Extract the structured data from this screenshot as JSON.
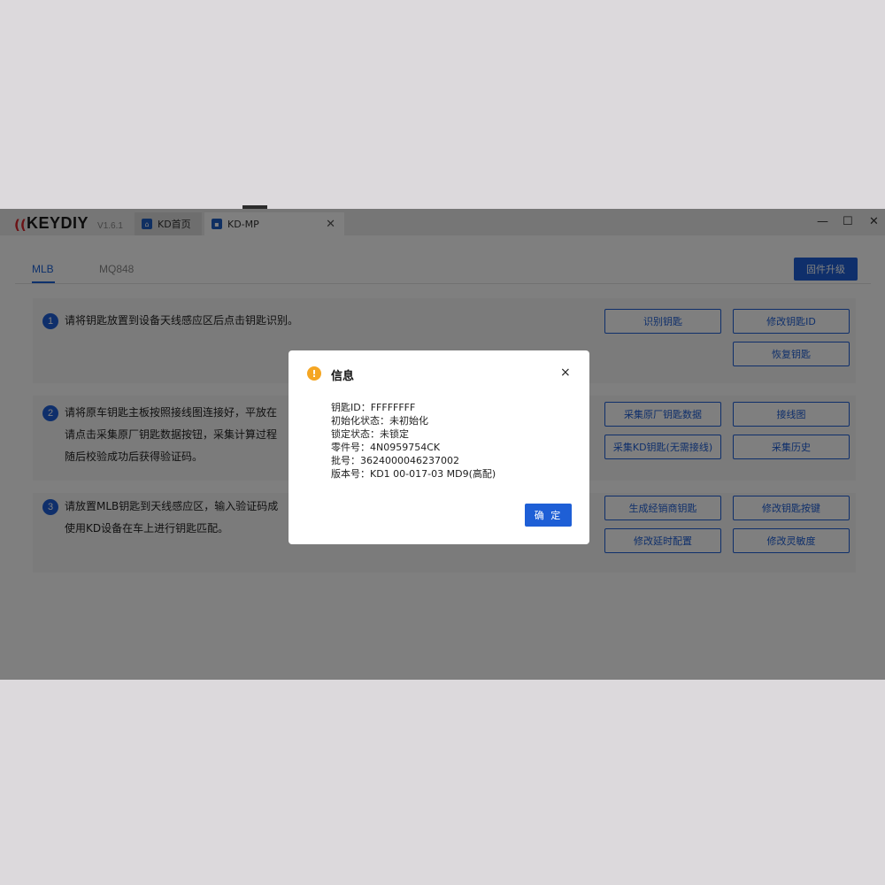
{
  "app": {
    "logo_text": "KEYDIY",
    "version": "V1.6.1"
  },
  "tabs": [
    {
      "label": "KD首页",
      "icon": "home-icon"
    },
    {
      "label": "KD-MP",
      "icon": "mp-icon"
    }
  ],
  "window_controls": {
    "minimize": "—",
    "maximize": "☐",
    "close": "✕"
  },
  "subtabs": [
    "MLB",
    "MQ848"
  ],
  "firmware_button": "固件升级",
  "sections": [
    {
      "number": "1",
      "lines": [
        "请将钥匙放置到设备天线感应区后点击钥匙识别。"
      ],
      "buttons": [
        "识别钥匙",
        "修改钥匙ID",
        "恢复钥匙"
      ]
    },
    {
      "number": "2",
      "lines": [
        "请将原车钥匙主板按照接线图连接好，平放在",
        "请点击采集原厂钥匙数据按钮，采集计算过程",
        "随后校验成功后获得验证码。"
      ],
      "buttons": [
        "采集原厂钥匙数据",
        "接线图",
        "采集KD钥匙(无需接线)",
        "采集历史"
      ]
    },
    {
      "number": "3",
      "lines": [
        "请放置MLB钥匙到天线感应区，输入验证码成",
        "使用KD设备在车上进行钥匙匹配。"
      ],
      "buttons": [
        "生成经销商钥匙",
        "修改钥匙按键",
        "修改延时配置",
        "修改灵敏度"
      ]
    }
  ],
  "dialog": {
    "title": "信息",
    "icon": "warning-icon",
    "close": "×",
    "lines": [
      "钥匙ID：FFFFFFFF",
      "初始化状态：未初始化",
      "锁定状态：未锁定",
      "零件号：4N0959754CK",
      "批号：3624000046237002",
      "版本号：KD1 00-017-03 MD9(高配)"
    ],
    "ok_button": "确 定"
  },
  "colors": {
    "accent": "#1e5fd6",
    "warning": "#f5a623",
    "brand_red": "#d7242a"
  }
}
